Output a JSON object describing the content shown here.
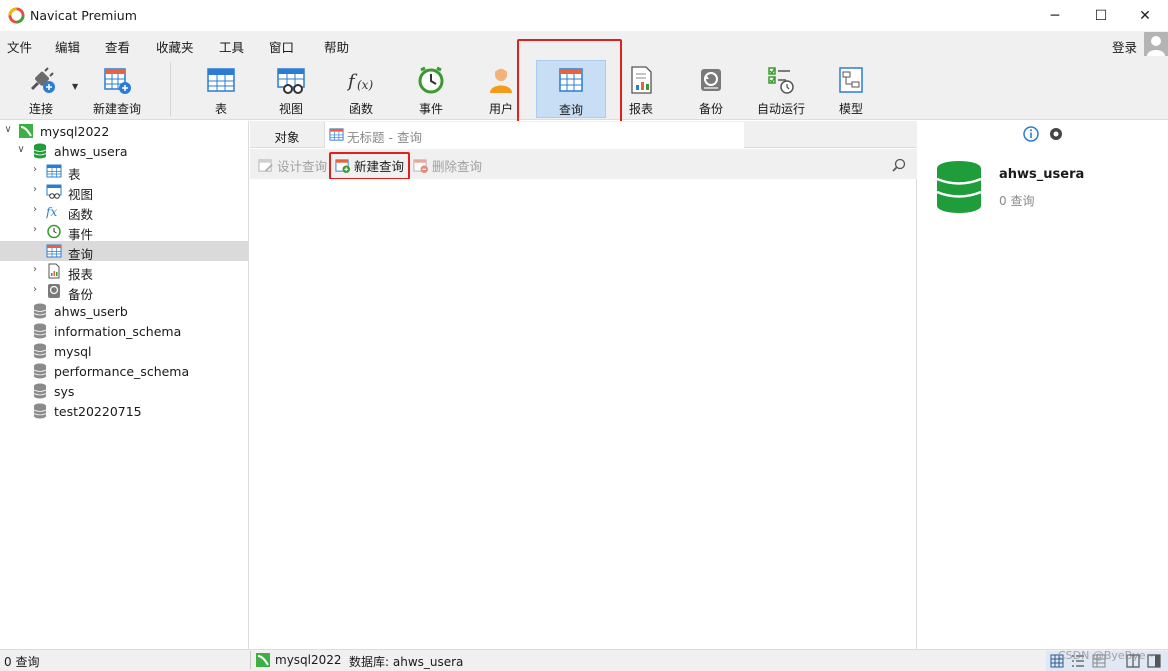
{
  "app": {
    "title": "Navicat Premium",
    "login_label": "登录"
  },
  "menu": [
    "文件",
    "编辑",
    "查看",
    "收藏夹",
    "工具",
    "窗口",
    "帮助"
  ],
  "toolbar": {
    "connect": "连接",
    "new_query": "新建查询",
    "items": [
      "表",
      "视图",
      "函数",
      "事件",
      "用户",
      "查询",
      "报表",
      "备份",
      "自动运行",
      "模型"
    ],
    "selected": "查询"
  },
  "tree": {
    "connection": "mysql2022",
    "open_db": "ahws_usera",
    "children": [
      "表",
      "视图",
      "函数",
      "事件",
      "查询",
      "报表",
      "备份"
    ],
    "other_dbs": [
      "ahws_userb",
      "information_schema",
      "mysql",
      "performance_schema",
      "sys",
      "test20220715"
    ]
  },
  "tabs": {
    "objects": "对象",
    "untitled": "无标题 - 查询"
  },
  "object_toolbar": {
    "design": "设计查询",
    "new": "新建查询",
    "delete": "删除查询"
  },
  "info": {
    "db_name": "ahws_usera",
    "count": "0 查询"
  },
  "status": {
    "left": "0 查询",
    "connection": "mysql2022",
    "database": "数据库: ahws_usera",
    "watermark": "CSDN @ByeBye~"
  },
  "colors": {
    "accent_selected": "#c8def5",
    "highlight": "#e0201c",
    "db_green": "#1f9d3a"
  }
}
